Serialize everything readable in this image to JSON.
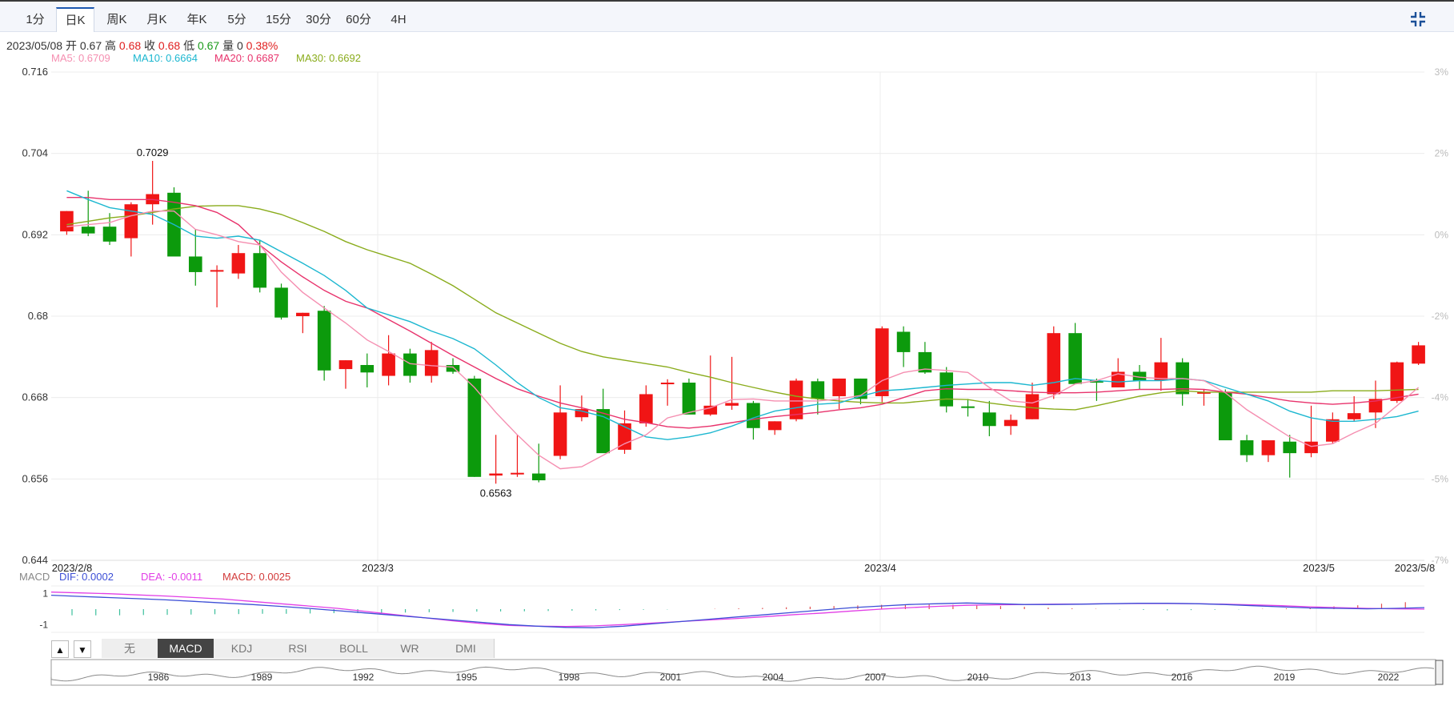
{
  "tabs": [
    {
      "label": "1分",
      "active": false
    },
    {
      "label": "日K",
      "active": true
    },
    {
      "label": "周K",
      "active": false
    },
    {
      "label": "月K",
      "active": false
    },
    {
      "label": "年K",
      "active": false
    },
    {
      "label": "5分",
      "active": false
    },
    {
      "label": "15分",
      "active": false
    },
    {
      "label": "30分",
      "active": false
    },
    {
      "label": "60分",
      "active": false
    },
    {
      "label": "4H",
      "active": false
    }
  ],
  "info": {
    "date": "2023/05/08",
    "open_label": "开",
    "open": "0.67",
    "high_label": "高",
    "high": "0.68",
    "close_label": "收",
    "close": "0.68",
    "low_label": "低",
    "low": "0.67",
    "vol_label": "量",
    "vol": "0",
    "change": "0.38%"
  },
  "ma_legend": [
    {
      "text": "MA5: 0.6709",
      "color": "#f58fb1"
    },
    {
      "text": "MA10: 0.6664",
      "color": "#1cb7d0"
    },
    {
      "text": "MA20: 0.6687",
      "color": "#e8336c"
    },
    {
      "text": "MA30: 0.6692",
      "color": "#8aac1c"
    }
  ],
  "macd_legend": {
    "label": "MACD",
    "dif": "DIF: 0.0002",
    "dea": "DEA: -0.0011",
    "macd": "MACD: 0.0025"
  },
  "indicator_tabs": [
    {
      "label": "无",
      "active": false
    },
    {
      "label": "MACD",
      "active": true
    },
    {
      "label": "KDJ",
      "active": false
    },
    {
      "label": "RSI",
      "active": false
    },
    {
      "label": "BOLL",
      "active": false
    },
    {
      "label": "WR",
      "active": false
    },
    {
      "label": "DMI",
      "active": false
    }
  ],
  "arrows": {
    "up": "▲",
    "down": "▼"
  },
  "colors": {
    "up": "#f01515",
    "down": "#0c9a0c",
    "ma5": "#f58fb1",
    "ma10": "#1cb7d0",
    "ma20": "#e8336c",
    "ma30": "#8aac1c",
    "dif": "#3d4fd6",
    "dea": "#e23fe6"
  },
  "chart_data": [
    {
      "type": "candlestick",
      "title": "",
      "y_ticks": [
        "0.716",
        "0.704",
        "0.692",
        "0.68",
        "0.668",
        "0.656",
        "0.644"
      ],
      "ylim": [
        0.644,
        0.716
      ],
      "pct_ticks": [
        "3%",
        "2%",
        "0%",
        "-2%",
        "-4%",
        "-5%",
        "-7%"
      ],
      "x_labels": [
        "2023/2/8",
        "2023/3",
        "2023/4",
        "2023/5",
        "2023/5/8"
      ],
      "high_annotation": "0.7029",
      "low_annotation": "0.6563",
      "series_ohlc": [
        [
          0.6925,
          0.6955,
          0.692,
          0.6955
        ],
        [
          0.6932,
          0.6985,
          0.6918,
          0.6922
        ],
        [
          0.6932,
          0.6952,
          0.6905,
          0.691
        ],
        [
          0.6915,
          0.6968,
          0.6888,
          0.6965
        ],
        [
          0.6965,
          0.7029,
          0.6935,
          0.698
        ],
        [
          0.6982,
          0.699,
          0.6935,
          0.6888
        ],
        [
          0.6888,
          0.6928,
          0.6845,
          0.6865
        ],
        [
          0.6866,
          0.6875,
          0.6813,
          0.6868
        ],
        [
          0.6863,
          0.6905,
          0.6855,
          0.6893
        ],
        [
          0.6893,
          0.6912,
          0.6835,
          0.6842
        ],
        [
          0.6842,
          0.6848,
          0.6795,
          0.6798
        ],
        [
          0.68,
          0.6805,
          0.6775,
          0.6805
        ],
        [
          0.6808,
          0.6815,
          0.6705,
          0.672
        ],
        [
          0.6722,
          0.6735,
          0.6693,
          0.6735
        ],
        [
          0.6728,
          0.6745,
          0.6695,
          0.6717
        ],
        [
          0.6712,
          0.6772,
          0.6698,
          0.6745
        ],
        [
          0.6745,
          0.6752,
          0.6702,
          0.6712
        ],
        [
          0.6712,
          0.6762,
          0.6702,
          0.675
        ],
        [
          0.6728,
          0.6738,
          0.6715,
          0.6718
        ],
        [
          0.6708,
          0.6712,
          0.6563,
          0.6563
        ],
        [
          0.6565,
          0.6625,
          0.6553,
          0.6568
        ],
        [
          0.6569,
          0.6625,
          0.6563,
          0.6569
        ],
        [
          0.6568,
          0.6612,
          0.6555,
          0.6558
        ],
        [
          0.6594,
          0.6698,
          0.6589,
          0.6658
        ],
        [
          0.6651,
          0.6683,
          0.6645,
          0.6663
        ],
        [
          0.6663,
          0.6693,
          0.6602,
          0.6598
        ],
        [
          0.6603,
          0.6661,
          0.6597,
          0.6642
        ],
        [
          0.6642,
          0.6698,
          0.6637,
          0.6685
        ],
        [
          0.6701,
          0.6707,
          0.6668,
          0.6702
        ],
        [
          0.6702,
          0.6708,
          0.6658,
          0.6655
        ],
        [
          0.6655,
          0.6742,
          0.6653,
          0.6668
        ],
        [
          0.6668,
          0.674,
          0.6662,
          0.6672
        ],
        [
          0.6672,
          0.6675,
          0.6618,
          0.6635
        ],
        [
          0.6632,
          0.6645,
          0.6625,
          0.6645
        ],
        [
          0.6648,
          0.6708,
          0.6645,
          0.6705
        ],
        [
          0.6704,
          0.6708,
          0.6655,
          0.6678
        ],
        [
          0.6682,
          0.6708,
          0.6663,
          0.6708
        ],
        [
          0.6708,
          0.6708,
          0.667,
          0.6678
        ],
        [
          0.6682,
          0.6785,
          0.6673,
          0.6782
        ],
        [
          0.6777,
          0.6785,
          0.6725,
          0.6747
        ],
        [
          0.6747,
          0.6762,
          0.6715,
          0.6717
        ],
        [
          0.6717,
          0.6725,
          0.6658,
          0.6667
        ],
        [
          0.6667,
          0.6678,
          0.6652,
          0.6665
        ],
        [
          0.6658,
          0.6675,
          0.6623,
          0.6638
        ],
        [
          0.6638,
          0.6655,
          0.6625,
          0.6647
        ],
        [
          0.6648,
          0.6702,
          0.6648,
          0.6685
        ],
        [
          0.6685,
          0.6785,
          0.6678,
          0.6775
        ],
        [
          0.6775,
          0.679,
          0.6708,
          0.67
        ],
        [
          0.6705,
          0.6708,
          0.6675,
          0.6702
        ],
        [
          0.6695,
          0.6738,
          0.6695,
          0.6718
        ],
        [
          0.6718,
          0.6728,
          0.6692,
          0.6705
        ],
        [
          0.6705,
          0.6768,
          0.669,
          0.6732
        ],
        [
          0.6732,
          0.6738,
          0.6668,
          0.6685
        ],
        [
          0.6688,
          0.6692,
          0.6668,
          0.6688
        ],
        [
          0.6688,
          0.6692,
          0.6655,
          0.6617
        ],
        [
          0.6617,
          0.6625,
          0.6585,
          0.6595
        ],
        [
          0.6595,
          0.6608,
          0.6585,
          0.6617
        ],
        [
          0.6615,
          0.6625,
          0.6562,
          0.6598
        ],
        [
          0.6598,
          0.6668,
          0.6592,
          0.6615
        ],
        [
          0.6615,
          0.6658,
          0.6612,
          0.6648
        ],
        [
          0.6648,
          0.6682,
          0.6645,
          0.6657
        ],
        [
          0.6658,
          0.6705,
          0.6635,
          0.6678
        ],
        [
          0.6675,
          0.6733,
          0.6672,
          0.6732
        ],
        [
          0.673,
          0.6762,
          0.6728,
          0.6757
        ]
      ],
      "ma5": [
        0.6932,
        0.6935,
        0.6938,
        0.6948,
        0.6955,
        0.6955,
        0.6928,
        0.692,
        0.691,
        0.6905,
        0.6865,
        0.6835,
        0.6812,
        0.679,
        0.6765,
        0.6748,
        0.673,
        0.6727,
        0.6725,
        0.6695,
        0.6658,
        0.6625,
        0.6595,
        0.6575,
        0.6578,
        0.6595,
        0.6612,
        0.6625,
        0.665,
        0.6658,
        0.6665,
        0.6677,
        0.6678,
        0.6675,
        0.6675,
        0.6675,
        0.6678,
        0.6683,
        0.6705,
        0.6717,
        0.6722,
        0.672,
        0.6717,
        0.6695,
        0.6675,
        0.6672,
        0.6683,
        0.67,
        0.6705,
        0.6715,
        0.671,
        0.6708,
        0.6708,
        0.6705,
        0.6687,
        0.6662,
        0.6642,
        0.6622,
        0.6608,
        0.6612,
        0.6628,
        0.6642,
        0.6668,
        0.6695
      ],
      "ma10": [
        0.6985,
        0.6972,
        0.696,
        0.6955,
        0.695,
        0.6935,
        0.6918,
        0.6915,
        0.6918,
        0.6912,
        0.6895,
        0.6878,
        0.686,
        0.6838,
        0.6812,
        0.6802,
        0.6792,
        0.6778,
        0.6767,
        0.6752,
        0.6728,
        0.6702,
        0.668,
        0.6665,
        0.666,
        0.6652,
        0.6637,
        0.6622,
        0.6618,
        0.6622,
        0.6628,
        0.6638,
        0.665,
        0.666,
        0.6665,
        0.667,
        0.6672,
        0.6682,
        0.669,
        0.6692,
        0.6695,
        0.6698,
        0.67,
        0.6702,
        0.6702,
        0.6698,
        0.6702,
        0.6708,
        0.6705,
        0.6703,
        0.6705,
        0.6705,
        0.6708,
        0.6705,
        0.6695,
        0.6685,
        0.6675,
        0.666,
        0.665,
        0.6645,
        0.6645,
        0.6648,
        0.6652,
        0.666
      ],
      "ma20": [
        0.6975,
        0.6975,
        0.6972,
        0.6972,
        0.6972,
        0.6968,
        0.6963,
        0.6953,
        0.6935,
        0.6905,
        0.688,
        0.6858,
        0.6838,
        0.6822,
        0.6812,
        0.6795,
        0.6778,
        0.676,
        0.6742,
        0.6725,
        0.6708,
        0.6693,
        0.6682,
        0.6672,
        0.6665,
        0.6657,
        0.6648,
        0.6643,
        0.6637,
        0.6635,
        0.6638,
        0.6643,
        0.6648,
        0.6652,
        0.6655,
        0.6658,
        0.6662,
        0.6665,
        0.667,
        0.668,
        0.669,
        0.6693,
        0.6692,
        0.6692,
        0.669,
        0.6688,
        0.6687,
        0.6687,
        0.6688,
        0.669,
        0.6692,
        0.6692,
        0.6693,
        0.6692,
        0.6688,
        0.6685,
        0.668,
        0.6675,
        0.6672,
        0.667,
        0.6672,
        0.6675,
        0.668,
        0.6685
      ],
      "ma30": [
        0.6935,
        0.694,
        0.6945,
        0.6948,
        0.6953,
        0.6958,
        0.6962,
        0.6963,
        0.6963,
        0.6958,
        0.695,
        0.6938,
        0.6925,
        0.691,
        0.6898,
        0.6888,
        0.6878,
        0.6862,
        0.6845,
        0.6825,
        0.6805,
        0.679,
        0.6775,
        0.676,
        0.6748,
        0.674,
        0.6735,
        0.673,
        0.6725,
        0.6717,
        0.671,
        0.6702,
        0.6695,
        0.6688,
        0.6682,
        0.6678,
        0.6675,
        0.6673,
        0.6672,
        0.6672,
        0.6675,
        0.6678,
        0.6677,
        0.6672,
        0.6668,
        0.6665,
        0.6663,
        0.6662,
        0.6668,
        0.6675,
        0.6682,
        0.6687,
        0.669,
        0.6688,
        0.6688,
        0.6688,
        0.6688,
        0.6688,
        0.6688,
        0.669,
        0.669,
        0.669,
        0.6691,
        0.6692
      ]
    },
    {
      "type": "macd",
      "y_ticks": [
        "1",
        "-1"
      ],
      "ylim": [
        -1.5,
        1.5
      ],
      "dif": [
        0.9,
        0.82,
        0.75,
        0.68,
        0.6,
        0.5,
        0.4,
        0.3,
        0.18,
        0.05,
        -0.1,
        -0.25,
        -0.4,
        -0.55,
        -0.7,
        -0.85,
        -1.0,
        -1.1,
        -1.18,
        -1.2,
        -1.1,
        -0.95,
        -0.8,
        -0.65,
        -0.5,
        -0.35,
        -0.2,
        -0.05,
        0.1,
        0.2,
        0.3,
        0.35,
        0.4,
        0.35,
        0.3,
        0.3,
        0.32,
        0.35,
        0.38,
        0.38,
        0.35,
        0.3,
        0.22,
        0.15,
        0.08,
        0.05,
        0.02,
        0.05,
        0.1
      ],
      "dea": [
        1.1,
        1.05,
        1.0,
        0.92,
        0.85,
        0.75,
        0.65,
        0.5,
        0.35,
        0.2,
        0.05,
        -0.15,
        -0.35,
        -0.55,
        -0.75,
        -0.92,
        -1.05,
        -1.1,
        -1.12,
        -1.08,
        -1.0,
        -0.9,
        -0.8,
        -0.7,
        -0.6,
        -0.48,
        -0.35,
        -0.25,
        -0.12,
        0.0,
        0.1,
        0.18,
        0.25,
        0.28,
        0.3,
        0.32,
        0.33,
        0.35,
        0.36,
        0.36,
        0.35,
        0.32,
        0.28,
        0.22,
        0.15,
        0.1,
        0.05,
        0.02,
        0.0
      ],
      "histogram": [
        -0.4,
        -0.4,
        -0.4,
        -0.38,
        -0.37,
        -0.35,
        -0.33,
        -0.32,
        -0.3,
        -0.3,
        -0.28,
        -0.26,
        -0.25,
        -0.24,
        -0.22,
        -0.2,
        -0.18,
        -0.16,
        -0.15,
        -0.14,
        -0.12,
        -0.1,
        -0.08,
        -0.06,
        -0.04,
        -0.02,
        0.0,
        0.02,
        0.05,
        0.08,
        0.12,
        0.16,
        0.2,
        0.24,
        0.28,
        0.3,
        0.3,
        0.28,
        0.25,
        0.2,
        0.15,
        0.1,
        0.05,
        0.02,
        -0.02,
        -0.05,
        -0.08,
        -0.06,
        -0.04,
        -0.02,
        0.02,
        0.05,
        0.1,
        0.18,
        0.25,
        0.35,
        0.45
      ]
    },
    {
      "type": "area",
      "x_labels": [
        "1986",
        "1989",
        "1992",
        "1995",
        "1998",
        "2001",
        "2004",
        "2007",
        "2010",
        "2013",
        "2016",
        "2019",
        "2022"
      ]
    }
  ]
}
